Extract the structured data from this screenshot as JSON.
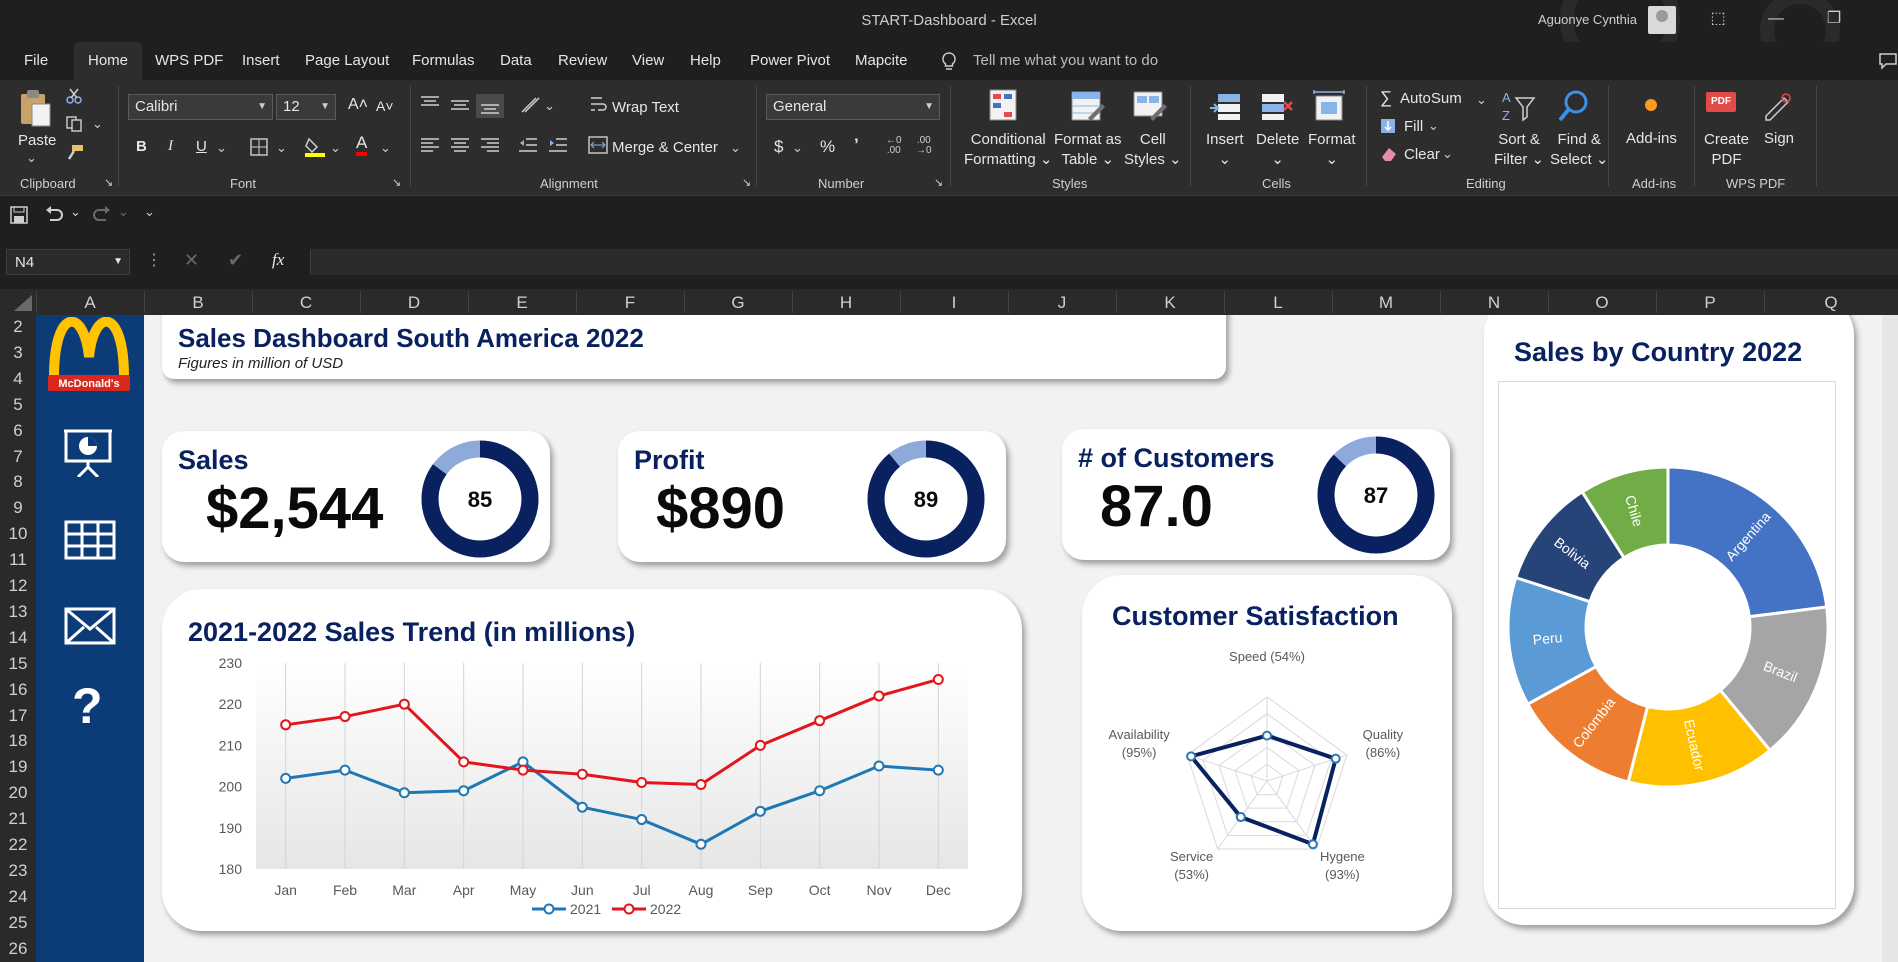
{
  "window": {
    "title": "START-Dashboard  -  Excel",
    "user": "Aguonye Cynthia"
  },
  "menu": [
    "File",
    "Home",
    "WPS PDF",
    "Insert",
    "Page Layout",
    "Formulas",
    "Data",
    "Review",
    "View",
    "Help",
    "Power Pivot",
    "Mapcite"
  ],
  "tell_me": "Tell me what you want to do",
  "ribbon": {
    "clipboard": {
      "paste": "Paste",
      "group": "Clipboard"
    },
    "font": {
      "name": "Calibri",
      "size": "12",
      "group": "Font"
    },
    "alignment": {
      "wrap": "Wrap Text",
      "merge": "Merge & Center",
      "group": "Alignment"
    },
    "number": {
      "format": "General",
      "group": "Number"
    },
    "styles": {
      "conditional": "Conditional",
      "formatting": "Formatting",
      "format_as": "Format as",
      "table": "Table",
      "cell": "Cell",
      "styles": "Styles",
      "group": "Styles"
    },
    "cells": {
      "insert": "Insert",
      "delete": "Delete",
      "format": "Format",
      "group": "Cells"
    },
    "editing": {
      "autosum": "AutoSum",
      "fill": "Fill",
      "clear": "Clear",
      "sort": "Sort &",
      "filter": "Filter",
      "find": "Find &",
      "select": "Select",
      "group": "Editing"
    },
    "addins": {
      "label": "Add-ins",
      "group": "Add-ins"
    },
    "wps": {
      "create": "Create",
      "pdf": "PDF",
      "sign": "Sign",
      "group": "WPS PDF",
      "badge": "PDF"
    }
  },
  "namebox": "N4",
  "columns": [
    "A",
    "B",
    "C",
    "D",
    "E",
    "F",
    "G",
    "H",
    "I",
    "J",
    "K",
    "L",
    "M",
    "N",
    "O",
    "P",
    "Q"
  ],
  "rows": [
    "2",
    "3",
    "4",
    "5",
    "6",
    "7",
    "8",
    "9",
    "10",
    "11",
    "12",
    "13",
    "14",
    "15",
    "16",
    "17",
    "18",
    "19",
    "20",
    "21",
    "22",
    "23",
    "24",
    "25",
    "26"
  ],
  "dashboard": {
    "logo_text": "McDonald's",
    "title": "Sales Dashboard South America 2022",
    "subtitle": "Figures in million of USD",
    "kpis": [
      {
        "label": "Sales",
        "value": "$2,544",
        "ring": "85",
        "fraction": 0.85
      },
      {
        "label": "Profit",
        "value": "$890",
        "ring": "89",
        "fraction": 0.89
      },
      {
        "label": "# of Customers",
        "value": "87.0",
        "ring": "87",
        "fraction": 0.87
      }
    ],
    "trend_title": "2021-2022 Sales Trend (in millions)",
    "satisfaction_title": "Customer Satisfaction",
    "country_title": "Sales by Country 2022"
  },
  "chart_data": [
    {
      "type": "line",
      "title": "2021-2022 Sales Trend (in millions)",
      "categories": [
        "Jan",
        "Feb",
        "Mar",
        "Apr",
        "May",
        "Jun",
        "Jul",
        "Aug",
        "Sep",
        "Oct",
        "Nov",
        "Dec"
      ],
      "ylim": [
        180,
        230
      ],
      "yticks": [
        "230",
        "220",
        "210",
        "200",
        "190",
        "180"
      ],
      "series": [
        {
          "name": "2021",
          "color": "#1f77b4",
          "values": [
            202,
            204,
            198.5,
            199,
            206,
            195,
            192,
            186,
            194,
            199,
            205,
            204
          ]
        },
        {
          "name": "2022",
          "color": "#e3161b",
          "values": [
            215,
            217,
            220,
            206,
            204,
            203,
            201,
            200.5,
            210,
            216,
            222,
            226
          ]
        }
      ],
      "legend": "bottom"
    },
    {
      "type": "radar",
      "title": "Customer Satisfaction",
      "categories": [
        "Speed (54%)",
        "Quality (86%)",
        "Hygene (93%)",
        "Service (53%)",
        "Availability (95%)"
      ],
      "label_lines": [
        [
          "Speed (54%)"
        ],
        [
          "Quality",
          "(86%)"
        ],
        [
          "Hygene",
          "(93%)"
        ],
        [
          "Service",
          "(53%)"
        ],
        [
          "Availability",
          "(95%)"
        ]
      ],
      "values": [
        54,
        86,
        93,
        53,
        95
      ],
      "range": [
        0,
        100
      ]
    },
    {
      "type": "pie",
      "title": "Sales by Country 2022",
      "donut": true,
      "slices": [
        {
          "label": "Argentina",
          "value": 23,
          "color": "#4472c4"
        },
        {
          "label": "Brazil",
          "value": 16,
          "color": "#a5a5a5"
        },
        {
          "label": "Ecuador",
          "value": 15,
          "color": "#ffc000"
        },
        {
          "label": "Colombia",
          "value": 13,
          "color": "#ed7d31"
        },
        {
          "label": "Peru",
          "value": 13,
          "color": "#5b9bd5"
        },
        {
          "label": "Bolivia",
          "value": 11,
          "color": "#264478"
        },
        {
          "label": "Chile",
          "value": 9,
          "color": "#70ad47"
        }
      ]
    }
  ]
}
